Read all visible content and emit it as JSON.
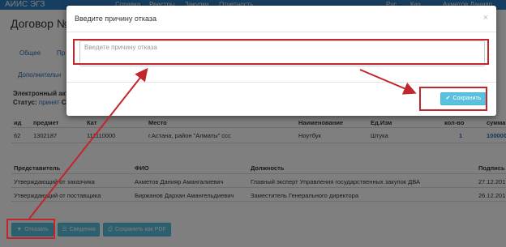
{
  "app": {
    "brand": "АИИС ЭГЗ"
  },
  "topnav": {
    "items": [
      "Справка",
      "Реестры",
      "Закупки",
      "Отчетность"
    ],
    "right": [
      "Рус",
      "Каз",
      "Ахметов Данияр Ам..."
    ]
  },
  "page": {
    "title": "Договор № 20",
    "tabs": [
      "Общее",
      "Пр",
      "Дополнительн"
    ],
    "info_line1": "Электронный акт",
    "status_label": "Статус:",
    "status_value": "принят",
    "status_tail": "Со"
  },
  "items_table": {
    "headers": [
      "ид",
      "предмет",
      "Кат",
      "Место",
      "Наименование",
      "Ед.Изм",
      "кол-во",
      "сумма"
    ],
    "row": [
      "62",
      "1302187",
      "111110000",
      "г.Астана, район \"Алматы\" ссс",
      "Ноутбук",
      "Штука",
      "1",
      "100000"
    ]
  },
  "signers_table": {
    "headers": [
      "Представитель",
      "ФИО",
      "Должность",
      "Подпись"
    ],
    "rows": [
      [
        "Утверждающий от заказчика",
        "Ахметов Данияр Амангалиевич",
        "Главный эксперт Управления государственных закупок ДВА",
        "27.12.2017"
      ],
      [
        "Утверждающий от поставщика",
        "Биржанов Дархан Амангельдиевич",
        "Заместитель Генерального директора",
        "26.12.2017"
      ]
    ]
  },
  "actions": {
    "reject": "Отказать",
    "details": "Сведения",
    "save_pdf": "Сохранить как PDF"
  },
  "modal": {
    "title": "Введите причину отказа",
    "close": "×",
    "textarea_placeholder": "Введите причину отказа",
    "save": "Сохранить"
  },
  "colors": {
    "primary": "#2c7cc0",
    "info": "#5bc0de",
    "annotation": "#c0262b"
  }
}
